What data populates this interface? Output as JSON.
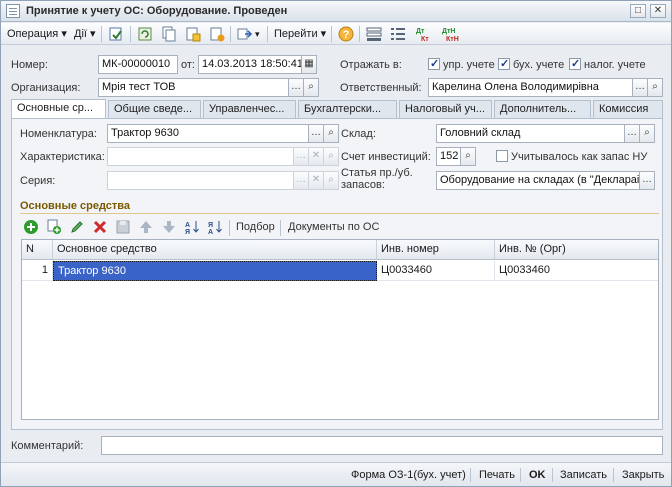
{
  "window": {
    "title": "Принятие к учету ОС: Оборудование. Проведен"
  },
  "toolbar": {
    "operation": "Операция",
    "actions": "Дії",
    "goto": "Перейти",
    "dt_kt_1": "Дт Кт",
    "dt_kt_2": "ДтН КтН"
  },
  "header": {
    "number_label": "Номер:",
    "number_value": "МК-00000010",
    "date_label": "от:",
    "date_value": "14.03.2013 18:50:41",
    "reflect_label": "Отражать в:",
    "reflect_mgmt": "упр. учете",
    "reflect_acc": "бух. учете",
    "reflect_tax": "налог. учете",
    "org_label": "Организация:",
    "org_value": "Мрія тест ТОВ",
    "resp_label": "Ответственный:",
    "resp_value": "Карелина Олена Володимирівна"
  },
  "tabs": [
    {
      "label": "Основные ср..."
    },
    {
      "label": "Общие сведе..."
    },
    {
      "label": "Управленчес..."
    },
    {
      "label": "Бухгалтерски..."
    },
    {
      "label": "Налоговый уч..."
    },
    {
      "label": "Дополнитель..."
    },
    {
      "label": "Комиссия"
    }
  ],
  "main": {
    "nomenclature_label": "Номенклатура:",
    "nomenclature_value": "Трактор 9630",
    "characteristic_label": "Характеристика:",
    "series_label": "Серия:",
    "warehouse_label": "Склад:",
    "warehouse_value": "Головний склад",
    "invest_label": "Счет инвестиций:",
    "invest_value": "152",
    "stock_label": "Учитывалось как запас НУ",
    "article_label_1": "Статья пр./уб.",
    "article_label_2": "запасов:",
    "article_value": "Оборудование на складах (в \"Деклараі"
  },
  "section": {
    "title": "Основные средства",
    "pick_label": "Подбор",
    "docs_label": "Документы по ОС"
  },
  "table": {
    "headers": [
      "N",
      "Основное средство",
      "Инв. номер",
      "Инв. № (Орг)"
    ],
    "rows": [
      {
        "n": "1",
        "asset": "Трактор 9630",
        "inv": "Ц0033460",
        "inv_org": "Ц0033460"
      }
    ]
  },
  "comment": {
    "label": "Комментарий:",
    "value": ""
  },
  "footer": {
    "form": "Форма ОЗ-1(бух. учет)",
    "print": "Печать",
    "ok": "OK",
    "save": "Записать",
    "close": "Закрыть"
  },
  "colors": {
    "selection": "#3a63c8",
    "section_title": "#7a5a00",
    "add_icon": "#2e9b2e",
    "delete_icon": "#d22a2a"
  }
}
